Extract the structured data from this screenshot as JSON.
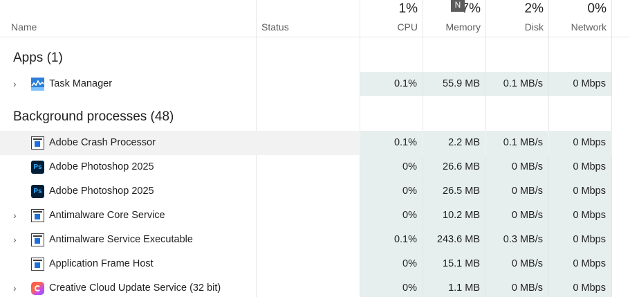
{
  "header": {
    "name_label": "Name",
    "status_label": "Status",
    "sort_chevron": "^",
    "tooltip_letter": "N",
    "columns": [
      {
        "pct": "1%",
        "label": "CPU"
      },
      {
        "pct": "7%",
        "label": "Memory"
      },
      {
        "pct": "2%",
        "label": "Disk"
      },
      {
        "pct": "0%",
        "label": "Network"
      }
    ]
  },
  "groups": {
    "apps": {
      "title": "Apps (1)"
    },
    "background": {
      "title": "Background processes (48)"
    }
  },
  "rows": [
    {
      "name": "Task Manager",
      "icon": "task-manager-icon",
      "expandable": true,
      "cpu": "0.1%",
      "memory": "55.9 MB",
      "disk": "0.1 MB/s",
      "network": "0 Mbps"
    },
    {
      "name": "Adobe Crash Processor",
      "icon": "app-window-icon",
      "expandable": false,
      "cpu": "0.1%",
      "memory": "2.2 MB",
      "disk": "0.1 MB/s",
      "network": "0 Mbps"
    },
    {
      "name": "Adobe Photoshop 2025",
      "icon": "photoshop-icon",
      "icon_text": "Ps",
      "expandable": false,
      "cpu": "0%",
      "memory": "26.6 MB",
      "disk": "0 MB/s",
      "network": "0 Mbps"
    },
    {
      "name": "Adobe Photoshop 2025",
      "icon": "photoshop-icon",
      "icon_text": "Ps",
      "expandable": false,
      "cpu": "0%",
      "memory": "26.5 MB",
      "disk": "0 MB/s",
      "network": "0 Mbps"
    },
    {
      "name": "Antimalware Core Service",
      "icon": "app-window-icon",
      "expandable": true,
      "cpu": "0%",
      "memory": "10.2 MB",
      "disk": "0 MB/s",
      "network": "0 Mbps"
    },
    {
      "name": "Antimalware Service Executable",
      "icon": "app-window-icon",
      "expandable": true,
      "cpu": "0.1%",
      "memory": "243.6 MB",
      "disk": "0.3 MB/s",
      "network": "0 Mbps"
    },
    {
      "name": "Application Frame Host",
      "icon": "app-window-icon",
      "expandable": false,
      "cpu": "0%",
      "memory": "15.1 MB",
      "disk": "0 MB/s",
      "network": "0 Mbps"
    },
    {
      "name": "Creative Cloud Update Service (32 bit)",
      "icon": "creative-cloud-icon",
      "expandable": true,
      "cpu": "0%",
      "memory": "1.1 MB",
      "disk": "0 MB/s",
      "network": "0 Mbps"
    }
  ],
  "expand_glyph": "›",
  "colors": {
    "usage_cell": "#e7eeee",
    "row_hover": "#f2f2f2",
    "tooltip_bg": "#5c5c5c"
  }
}
